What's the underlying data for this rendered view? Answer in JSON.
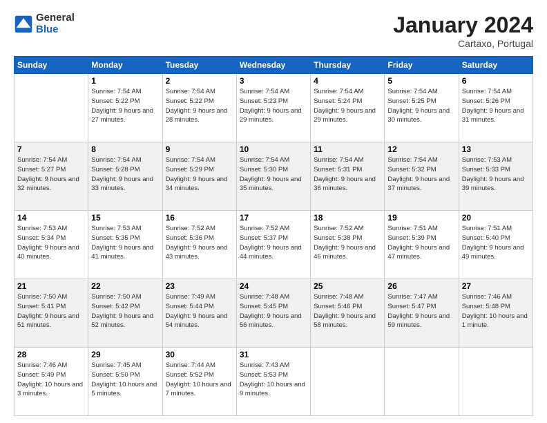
{
  "header": {
    "logo_general": "General",
    "logo_blue": "Blue",
    "month_title": "January 2024",
    "location": "Cartaxo, Portugal"
  },
  "weekdays": [
    "Sunday",
    "Monday",
    "Tuesday",
    "Wednesday",
    "Thursday",
    "Friday",
    "Saturday"
  ],
  "weeks": [
    [
      {
        "day": "",
        "sunrise": "",
        "sunset": "",
        "daylight": ""
      },
      {
        "day": "1",
        "sunrise": "Sunrise: 7:54 AM",
        "sunset": "Sunset: 5:22 PM",
        "daylight": "Daylight: 9 hours and 27 minutes."
      },
      {
        "day": "2",
        "sunrise": "Sunrise: 7:54 AM",
        "sunset": "Sunset: 5:22 PM",
        "daylight": "Daylight: 9 hours and 28 minutes."
      },
      {
        "day": "3",
        "sunrise": "Sunrise: 7:54 AM",
        "sunset": "Sunset: 5:23 PM",
        "daylight": "Daylight: 9 hours and 29 minutes."
      },
      {
        "day": "4",
        "sunrise": "Sunrise: 7:54 AM",
        "sunset": "Sunset: 5:24 PM",
        "daylight": "Daylight: 9 hours and 29 minutes."
      },
      {
        "day": "5",
        "sunrise": "Sunrise: 7:54 AM",
        "sunset": "Sunset: 5:25 PM",
        "daylight": "Daylight: 9 hours and 30 minutes."
      },
      {
        "day": "6",
        "sunrise": "Sunrise: 7:54 AM",
        "sunset": "Sunset: 5:26 PM",
        "daylight": "Daylight: 9 hours and 31 minutes."
      }
    ],
    [
      {
        "day": "7",
        "sunrise": "Sunrise: 7:54 AM",
        "sunset": "Sunset: 5:27 PM",
        "daylight": "Daylight: 9 hours and 32 minutes."
      },
      {
        "day": "8",
        "sunrise": "Sunrise: 7:54 AM",
        "sunset": "Sunset: 5:28 PM",
        "daylight": "Daylight: 9 hours and 33 minutes."
      },
      {
        "day": "9",
        "sunrise": "Sunrise: 7:54 AM",
        "sunset": "Sunset: 5:29 PM",
        "daylight": "Daylight: 9 hours and 34 minutes."
      },
      {
        "day": "10",
        "sunrise": "Sunrise: 7:54 AM",
        "sunset": "Sunset: 5:30 PM",
        "daylight": "Daylight: 9 hours and 35 minutes."
      },
      {
        "day": "11",
        "sunrise": "Sunrise: 7:54 AM",
        "sunset": "Sunset: 5:31 PM",
        "daylight": "Daylight: 9 hours and 36 minutes."
      },
      {
        "day": "12",
        "sunrise": "Sunrise: 7:54 AM",
        "sunset": "Sunset: 5:32 PM",
        "daylight": "Daylight: 9 hours and 37 minutes."
      },
      {
        "day": "13",
        "sunrise": "Sunrise: 7:53 AM",
        "sunset": "Sunset: 5:33 PM",
        "daylight": "Daylight: 9 hours and 39 minutes."
      }
    ],
    [
      {
        "day": "14",
        "sunrise": "Sunrise: 7:53 AM",
        "sunset": "Sunset: 5:34 PM",
        "daylight": "Daylight: 9 hours and 40 minutes."
      },
      {
        "day": "15",
        "sunrise": "Sunrise: 7:53 AM",
        "sunset": "Sunset: 5:35 PM",
        "daylight": "Daylight: 9 hours and 41 minutes."
      },
      {
        "day": "16",
        "sunrise": "Sunrise: 7:52 AM",
        "sunset": "Sunset: 5:36 PM",
        "daylight": "Daylight: 9 hours and 43 minutes."
      },
      {
        "day": "17",
        "sunrise": "Sunrise: 7:52 AM",
        "sunset": "Sunset: 5:37 PM",
        "daylight": "Daylight: 9 hours and 44 minutes."
      },
      {
        "day": "18",
        "sunrise": "Sunrise: 7:52 AM",
        "sunset": "Sunset: 5:38 PM",
        "daylight": "Daylight: 9 hours and 46 minutes."
      },
      {
        "day": "19",
        "sunrise": "Sunrise: 7:51 AM",
        "sunset": "Sunset: 5:39 PM",
        "daylight": "Daylight: 9 hours and 47 minutes."
      },
      {
        "day": "20",
        "sunrise": "Sunrise: 7:51 AM",
        "sunset": "Sunset: 5:40 PM",
        "daylight": "Daylight: 9 hours and 49 minutes."
      }
    ],
    [
      {
        "day": "21",
        "sunrise": "Sunrise: 7:50 AM",
        "sunset": "Sunset: 5:41 PM",
        "daylight": "Daylight: 9 hours and 51 minutes."
      },
      {
        "day": "22",
        "sunrise": "Sunrise: 7:50 AM",
        "sunset": "Sunset: 5:42 PM",
        "daylight": "Daylight: 9 hours and 52 minutes."
      },
      {
        "day": "23",
        "sunrise": "Sunrise: 7:49 AM",
        "sunset": "Sunset: 5:44 PM",
        "daylight": "Daylight: 9 hours and 54 minutes."
      },
      {
        "day": "24",
        "sunrise": "Sunrise: 7:48 AM",
        "sunset": "Sunset: 5:45 PM",
        "daylight": "Daylight: 9 hours and 56 minutes."
      },
      {
        "day": "25",
        "sunrise": "Sunrise: 7:48 AM",
        "sunset": "Sunset: 5:46 PM",
        "daylight": "Daylight: 9 hours and 58 minutes."
      },
      {
        "day": "26",
        "sunrise": "Sunrise: 7:47 AM",
        "sunset": "Sunset: 5:47 PM",
        "daylight": "Daylight: 9 hours and 59 minutes."
      },
      {
        "day": "27",
        "sunrise": "Sunrise: 7:46 AM",
        "sunset": "Sunset: 5:48 PM",
        "daylight": "Daylight: 10 hours and 1 minute."
      }
    ],
    [
      {
        "day": "28",
        "sunrise": "Sunrise: 7:46 AM",
        "sunset": "Sunset: 5:49 PM",
        "daylight": "Daylight: 10 hours and 3 minutes."
      },
      {
        "day": "29",
        "sunrise": "Sunrise: 7:45 AM",
        "sunset": "Sunset: 5:50 PM",
        "daylight": "Daylight: 10 hours and 5 minutes."
      },
      {
        "day": "30",
        "sunrise": "Sunrise: 7:44 AM",
        "sunset": "Sunset: 5:52 PM",
        "daylight": "Daylight: 10 hours and 7 minutes."
      },
      {
        "day": "31",
        "sunrise": "Sunrise: 7:43 AM",
        "sunset": "Sunset: 5:53 PM",
        "daylight": "Daylight: 10 hours and 9 minutes."
      },
      {
        "day": "",
        "sunrise": "",
        "sunset": "",
        "daylight": ""
      },
      {
        "day": "",
        "sunrise": "",
        "sunset": "",
        "daylight": ""
      },
      {
        "day": "",
        "sunrise": "",
        "sunset": "",
        "daylight": ""
      }
    ]
  ]
}
